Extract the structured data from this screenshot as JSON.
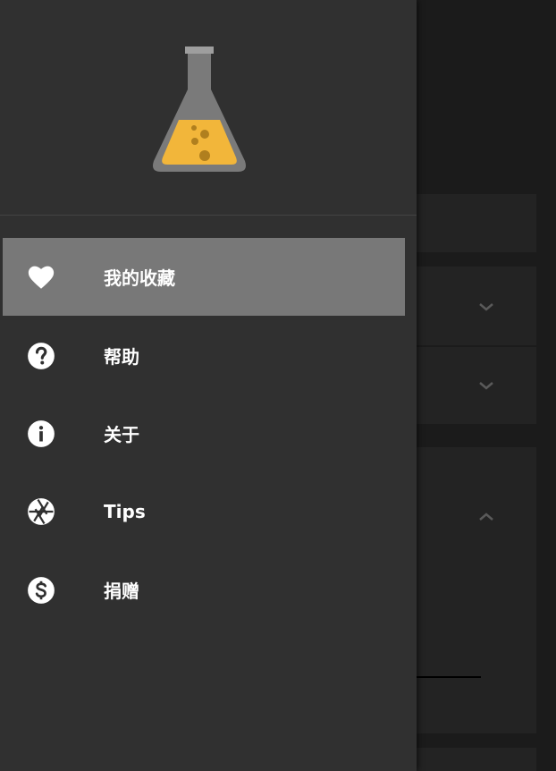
{
  "drawer": {
    "logo": "flask-icon",
    "items": [
      {
        "label": "我的收藏",
        "icon": "heart-icon",
        "active": true
      },
      {
        "label": "帮助",
        "icon": "help-circle-icon",
        "active": false
      },
      {
        "label": "关于",
        "icon": "info-circle-icon",
        "active": false
      },
      {
        "label": "Tips",
        "icon": "aperture-icon",
        "active": false
      },
      {
        "label": "捐赠",
        "icon": "dollar-circle-icon",
        "active": false
      }
    ]
  },
  "colors": {
    "drawer_bg": "#303030",
    "active_item_bg": "#787878",
    "flask_liquid": "#f2b63a",
    "flask_glass": "#7a7a7a"
  }
}
